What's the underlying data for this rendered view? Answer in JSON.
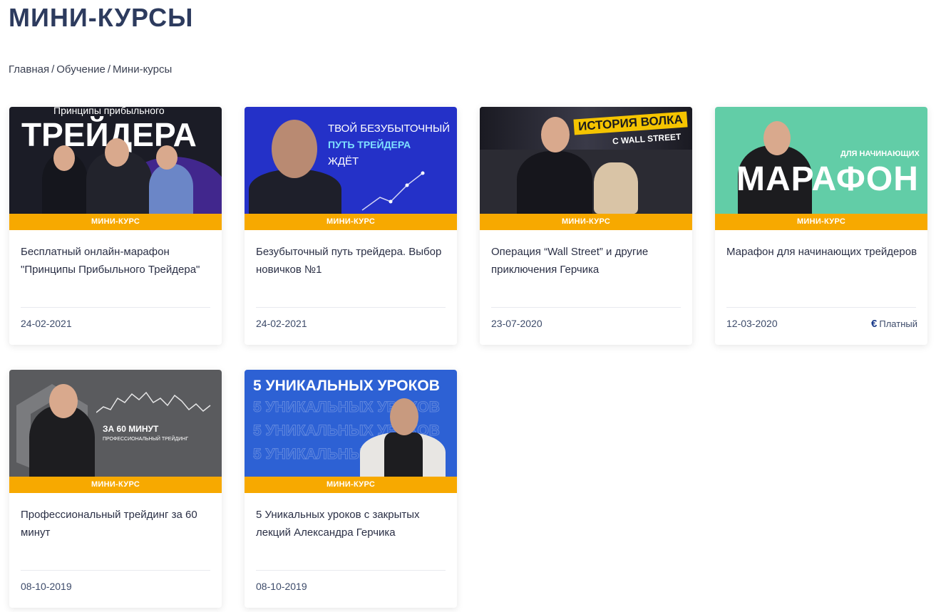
{
  "page": {
    "title": "МИНИ-КУРСЫ",
    "breadcrumb": [
      "Главная",
      "Обучение",
      "Мини-курсы"
    ],
    "breadcrumb_separator": "/"
  },
  "colors": {
    "accent": "#f7a900",
    "title": "#2d3b5e",
    "date": "#3d4b6a"
  },
  "cards": [
    {
      "badge": "МИНИ-КУРС",
      "title": "Бесплатный онлайн-марафон \"Принципы Прибыльного Трейдера\"",
      "date": "24-02-2021",
      "thumb": {
        "line1": "Принципы прибыльного",
        "line2": "ТРЕЙДЕРА"
      }
    },
    {
      "badge": "МИНИ-КУРС",
      "title": "Безубыточный путь трейдера. Выбор новичков №1",
      "date": "24-02-2021",
      "thumb": {
        "line1": "ТВОЙ БЕЗУБЫТОЧНЫЙ",
        "line2": "ПУТЬ ТРЕЙДЕРА",
        "line3": "ЖДЁТ"
      }
    },
    {
      "badge": "МИНИ-КУРС",
      "title": "Операция “Wall Street” и другие приключения Герчика",
      "date": "23-07-2020",
      "thumb": {
        "line1": "ИСТОРИЯ ВОЛКА",
        "line2": "С WALL STREET"
      }
    },
    {
      "badge": "МИНИ-КУРС",
      "title": "Марафон для начинающих трейдеров",
      "date": "12-03-2020",
      "price": "Платный",
      "price_icon": "euro-icon",
      "thumb": {
        "line1": "ДЛЯ НАЧИНАЮЩИХ",
        "line2": "МАРАФОН"
      }
    },
    {
      "badge": "МИНИ-КУРС",
      "title": "Профессиональный трейдинг за 60 минут",
      "date": "08-10-2019",
      "thumb": {
        "line1": "ЗА 60 МИНУТ",
        "line2": "ПРОФЕССИОНАЛЬНЫЙ ТРЕЙДИНГ"
      }
    },
    {
      "badge": "МИНИ-КУРС",
      "title": "5 Уникальных уроков с закрытых лекций Александра Герчика",
      "date": "08-10-2019",
      "thumb": {
        "line1": "5 УНИКАЛЬНЫХ УРОКОВ"
      }
    }
  ]
}
